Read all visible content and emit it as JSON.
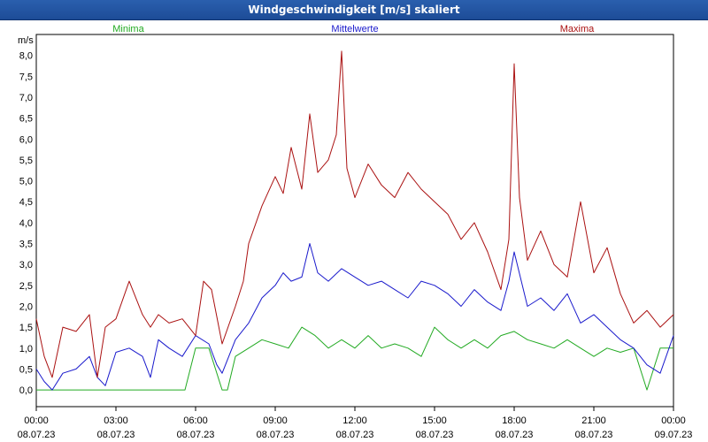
{
  "window": {
    "title": "Windgeschwindigkeit [m/s] skaliert"
  },
  "colors": {
    "minima": "#22aa22",
    "mittel": "#1a1acc",
    "maxima": "#aa1111"
  },
  "chart_data": {
    "type": "line",
    "title": "Windgeschwindigkeit [m/s] skaliert",
    "ylabel": "m/s",
    "ylim": [
      -0.4,
      8.5
    ],
    "y_ticks": [
      "0,0",
      "0,5",
      "1,0",
      "1,5",
      "2,0",
      "2,5",
      "3,0",
      "3,5",
      "4,0",
      "4,5",
      "5,0",
      "5,5",
      "6,0",
      "6,5",
      "7,0",
      "7,5",
      "8,0"
    ],
    "xlim": [
      0,
      24
    ],
    "x_ticks": [
      {
        "time": "00:00",
        "date": "08.07.23"
      },
      {
        "time": "03:00",
        "date": "08.07.23"
      },
      {
        "time": "06:00",
        "date": "08.07.23"
      },
      {
        "time": "09:00",
        "date": "08.07.23"
      },
      {
        "time": "12:00",
        "date": "08.07.23"
      },
      {
        "time": "15:00",
        "date": "08.07.23"
      },
      {
        "time": "18:00",
        "date": "08.07.23"
      },
      {
        "time": "21:00",
        "date": "08.07.23"
      },
      {
        "time": "00:00",
        "date": "09.07.23"
      }
    ],
    "grid": true,
    "legend_position": "top",
    "series": [
      {
        "name": "Minima",
        "x": [
          0,
          0.5,
          1,
          1.5,
          2,
          2.5,
          3,
          3.5,
          4,
          4.5,
          5,
          5.5,
          5.6,
          6,
          6.5,
          7,
          7.2,
          7.5,
          8,
          8.5,
          9,
          9.5,
          10,
          10.5,
          11,
          11.5,
          12,
          12.5,
          13,
          13.5,
          14,
          14.5,
          15,
          15.5,
          16,
          16.5,
          17,
          17.5,
          18,
          18.5,
          19,
          19.5,
          20,
          20.5,
          21,
          21.5,
          22,
          22.5,
          23,
          23.5,
          24
        ],
        "y": [
          0,
          0,
          0,
          0,
          0,
          0,
          0,
          0,
          0,
          0,
          0,
          0,
          0,
          1.0,
          1.0,
          0,
          0,
          0.8,
          1.0,
          1.2,
          1.1,
          1.0,
          1.5,
          1.3,
          1.0,
          1.2,
          1.0,
          1.3,
          1.0,
          1.1,
          1.0,
          0.8,
          1.5,
          1.2,
          1.0,
          1.2,
          1.0,
          1.3,
          1.4,
          1.2,
          1.1,
          1.0,
          1.2,
          1.0,
          0.8,
          1.0,
          0.9,
          1.0,
          0,
          1.0,
          1.0
        ]
      },
      {
        "name": "Mittelwerte",
        "x": [
          0,
          0.3,
          0.6,
          1,
          1.5,
          2,
          2.3,
          2.6,
          3,
          3.5,
          4,
          4.3,
          4.6,
          5,
          5.5,
          6,
          6.5,
          6.8,
          7,
          7.5,
          8,
          8.5,
          9,
          9.3,
          9.6,
          10,
          10.3,
          10.6,
          11,
          11.5,
          12,
          12.5,
          13,
          13.5,
          14,
          14.5,
          15,
          15.5,
          16,
          16.5,
          17,
          17.5,
          17.8,
          18,
          18.5,
          19,
          19.5,
          20,
          20.5,
          21,
          21.5,
          22,
          22.5,
          23,
          23.5,
          24
        ],
        "y": [
          0.5,
          0.2,
          0.0,
          0.4,
          0.5,
          0.8,
          0.3,
          0.1,
          0.9,
          1.0,
          0.8,
          0.3,
          1.2,
          1.0,
          0.8,
          1.3,
          1.1,
          0.6,
          0.4,
          1.2,
          1.6,
          2.2,
          2.5,
          2.8,
          2.6,
          2.7,
          3.5,
          2.8,
          2.6,
          2.9,
          2.7,
          2.5,
          2.6,
          2.4,
          2.2,
          2.6,
          2.5,
          2.3,
          2.0,
          2.4,
          2.1,
          1.9,
          2.6,
          3.3,
          2.0,
          2.2,
          1.9,
          2.3,
          1.6,
          1.8,
          1.5,
          1.2,
          1.0,
          0.6,
          0.4,
          1.3
        ]
      },
      {
        "name": "Maxima",
        "x": [
          0,
          0.3,
          0.6,
          1,
          1.5,
          2,
          2.3,
          2.6,
          3,
          3.5,
          4,
          4.3,
          4.6,
          5,
          5.5,
          6,
          6.3,
          6.6,
          7,
          7.5,
          7.8,
          8,
          8.5,
          9,
          9.3,
          9.6,
          10,
          10.3,
          10.6,
          11,
          11.3,
          11.5,
          11.7,
          12,
          12.5,
          13,
          13.5,
          14,
          14.5,
          15,
          15.5,
          16,
          16.5,
          17,
          17.5,
          17.8,
          18,
          18.2,
          18.5,
          19,
          19.5,
          20,
          20.5,
          21,
          21.5,
          22,
          22.5,
          23,
          23.5,
          24
        ],
        "y": [
          1.7,
          0.8,
          0.3,
          1.5,
          1.4,
          1.8,
          0.3,
          1.5,
          1.7,
          2.6,
          1.8,
          1.5,
          1.8,
          1.6,
          1.7,
          1.3,
          2.6,
          2.4,
          1.1,
          2.0,
          2.6,
          3.5,
          4.4,
          5.1,
          4.7,
          5.8,
          4.8,
          6.6,
          5.2,
          5.5,
          6.1,
          8.1,
          5.3,
          4.6,
          5.4,
          4.9,
          4.6,
          5.2,
          4.8,
          4.5,
          4.2,
          3.6,
          4.0,
          3.3,
          2.4,
          3.6,
          7.8,
          4.6,
          3.1,
          3.8,
          3.0,
          2.7,
          4.5,
          2.8,
          3.4,
          2.3,
          1.6,
          1.9,
          1.5,
          1.8
        ]
      }
    ]
  }
}
